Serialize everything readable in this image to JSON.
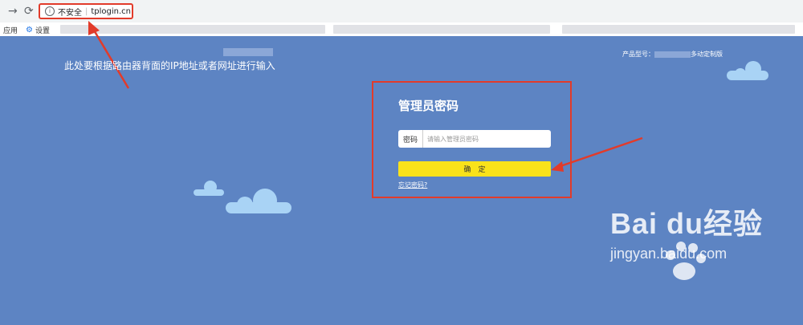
{
  "browser": {
    "back_icon": "arrow-right-icon",
    "reload_icon": "reload-icon",
    "security_label": "不安全",
    "url": "tplogin.cn"
  },
  "bookmarks": {
    "apps_label": "应用",
    "settings_label": "设置"
  },
  "page": {
    "product_model": "产品型号：",
    "product_suffix": "多动定制版",
    "annotation": "此处要根据路由器背面的IP地址或者网址进行输入",
    "login_title": "管理员密码",
    "password_label": "密码",
    "password_placeholder": "请输入管理员密码",
    "confirm_label": "确　定",
    "forgot_label": "忘记密码?"
  },
  "watermark": {
    "text": "Bai du经验",
    "url": "jingyan.baidu.com"
  },
  "colors": {
    "background": "#5d84c3",
    "annotation_red": "#e23b2a",
    "button_yellow": "#f9e21a"
  }
}
